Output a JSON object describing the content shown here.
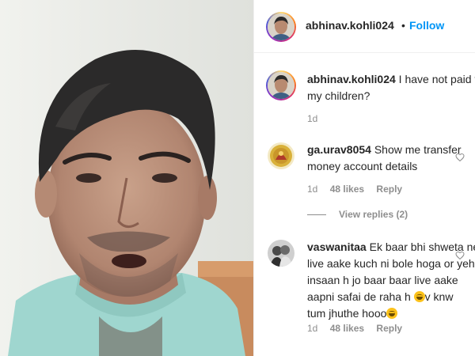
{
  "post": {
    "author": "abhinav.kohli024",
    "separator": "•",
    "follow_label": "Follow"
  },
  "caption": {
    "username": "abhinav.kohli024",
    "text_line1": "I have not paid fo",
    "text_line2": "my children?",
    "time": "1d"
  },
  "comments": [
    {
      "username": "ga.urav8054",
      "text_line1": "Show me transfer",
      "text_line2": "money account details",
      "time": "1d",
      "likes": "48 likes",
      "reply_label": "Reply",
      "view_replies": "View replies (2)"
    },
    {
      "username": "vaswanitaa",
      "text_line1": "Ek baar bhi shweta ne",
      "text_line2": "live aake kuch ni bole hoga or yeh",
      "text_line3": "insaan h jo baar baar live aake",
      "text_line4a": "aapni safai de raha h ",
      "text_line4b": "v knw",
      "text_line5": "tum jhuthe hooo",
      "time": "1d",
      "likes": "48 likes",
      "reply_label": "Reply"
    }
  ],
  "colors": {
    "follow_blue": "#0095f6",
    "meta_gray": "#8e8e8e",
    "text": "#262626",
    "divider": "#efefef"
  },
  "icons": {
    "comment_like": "heart-outline-icon",
    "emoji": "laughing-emoji-icon"
  }
}
